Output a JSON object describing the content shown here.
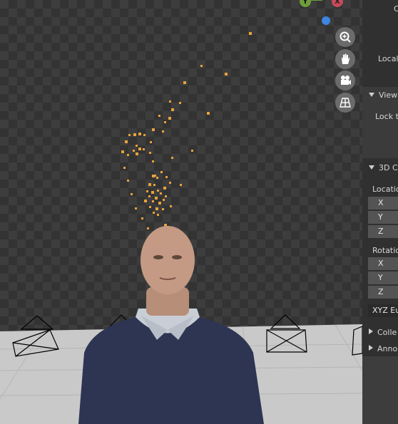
{
  "gizmo": {
    "y_label": "Y",
    "x_label": "X"
  },
  "nav_icons": [
    "zoom-icon",
    "hand-pan-icon",
    "camera-icon",
    "grid-icon"
  ],
  "sidebar": {
    "top_cut_label": "C",
    "local_label": "Local",
    "view_section": "View",
    "lock_label": "Lock t",
    "cursor_section": "3D C",
    "location_label": "Locatio",
    "location_axes": [
      "X",
      "Y",
      "Z"
    ],
    "rotation_label": "Rotatio",
    "rotation_axes": [
      "X",
      "Y",
      "Z"
    ],
    "rotation_mode": "XYZ Eu",
    "collections_section": "Colle",
    "annotations_section": "Anno"
  },
  "colors": {
    "point": "#e8a23c",
    "panel": "#303030",
    "field": "#545454"
  }
}
